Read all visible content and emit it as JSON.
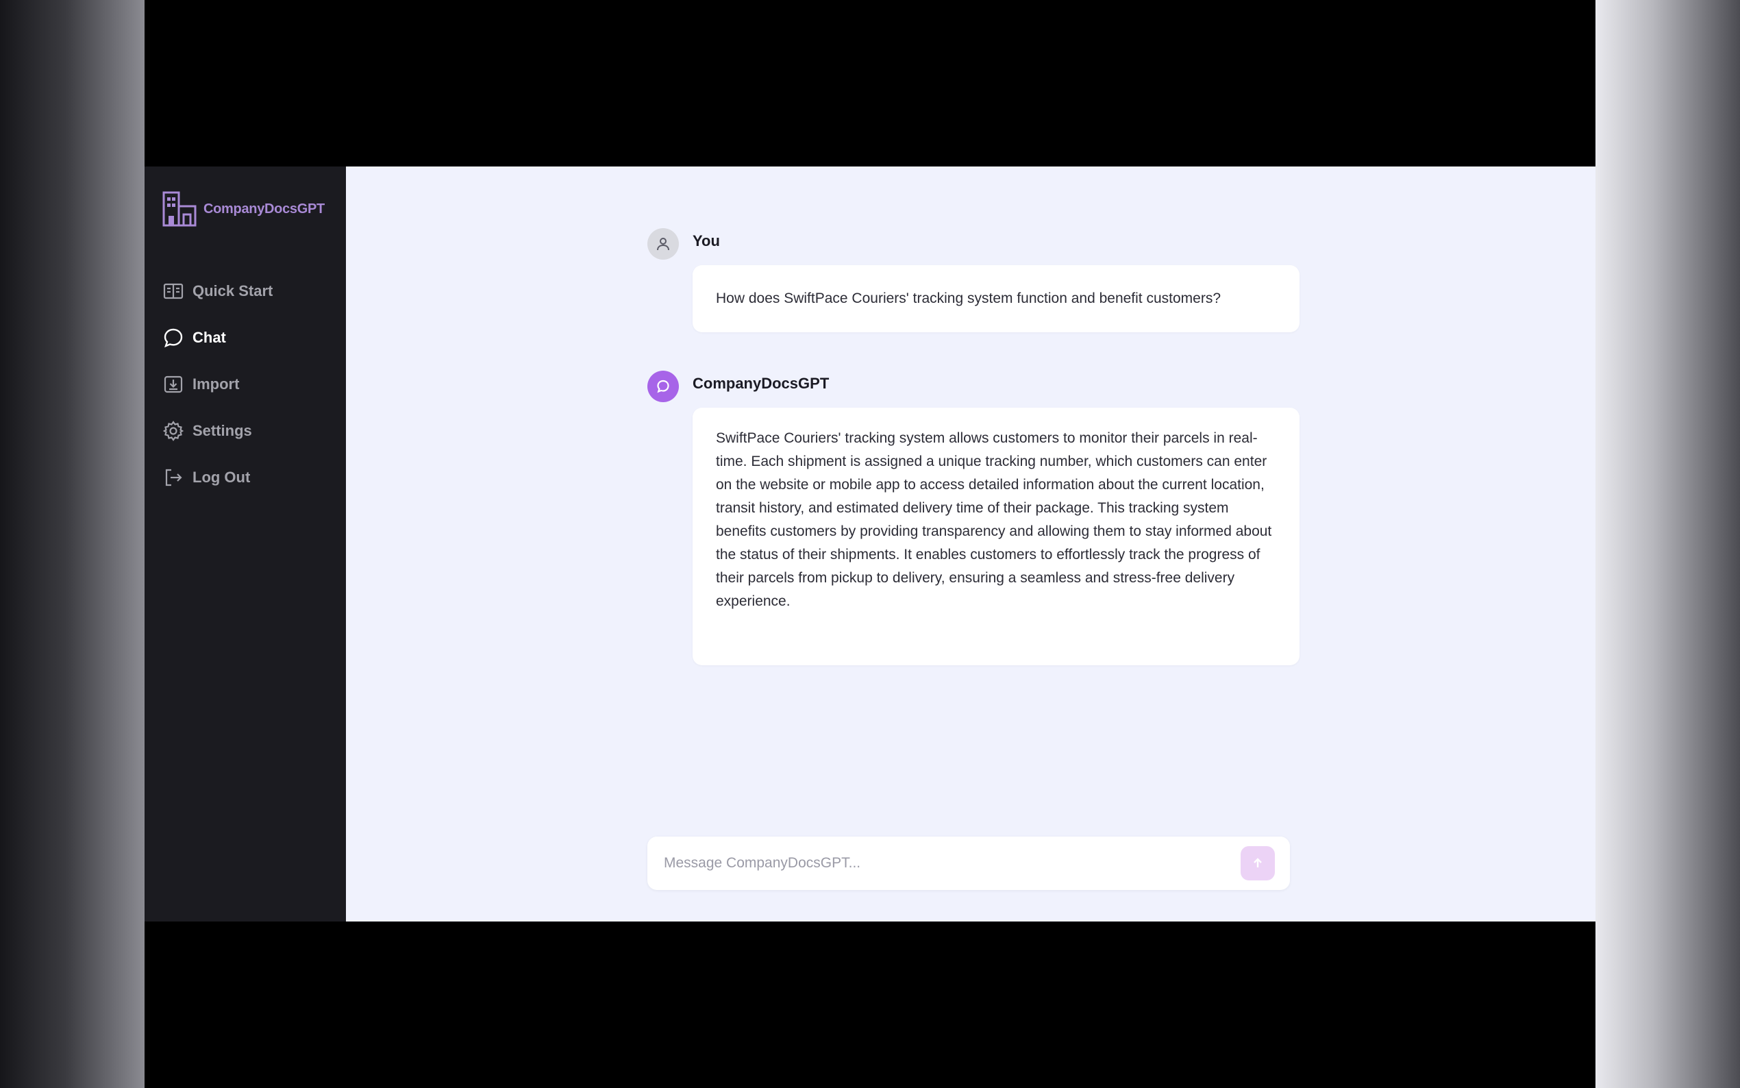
{
  "app": {
    "name": "CompanyDocsGPT",
    "accent": "#a764e8"
  },
  "sidebar": {
    "items": [
      {
        "label": "Quick Start",
        "icon": "book-icon"
      },
      {
        "label": "Chat",
        "icon": "chat-bubble-icon",
        "active": true
      },
      {
        "label": "Import",
        "icon": "import-icon"
      },
      {
        "label": "Settings",
        "icon": "gear-icon"
      },
      {
        "label": "Log Out",
        "icon": "logout-icon"
      }
    ]
  },
  "chat": {
    "messages": [
      {
        "sender": "You",
        "text": "How does SwiftPace Couriers' tracking system function and benefit customers?"
      },
      {
        "sender": "CompanyDocsGPT",
        "text": "SwiftPace Couriers' tracking system allows customers to monitor their parcels in real-time. Each shipment is assigned a unique tracking number, which customers can enter on the website or mobile app to access detailed information about the current location, transit history, and estimated delivery time of their package. This tracking system benefits customers by providing transparency and allowing them to stay informed about the status of their shipments. It enables customers to effortlessly track the progress of their parcels from pickup to delivery, ensuring a seamless and stress-free delivery experience."
      }
    ]
  },
  "composer": {
    "placeholder": "Message CompanyDocsGPT...",
    "value": ""
  }
}
